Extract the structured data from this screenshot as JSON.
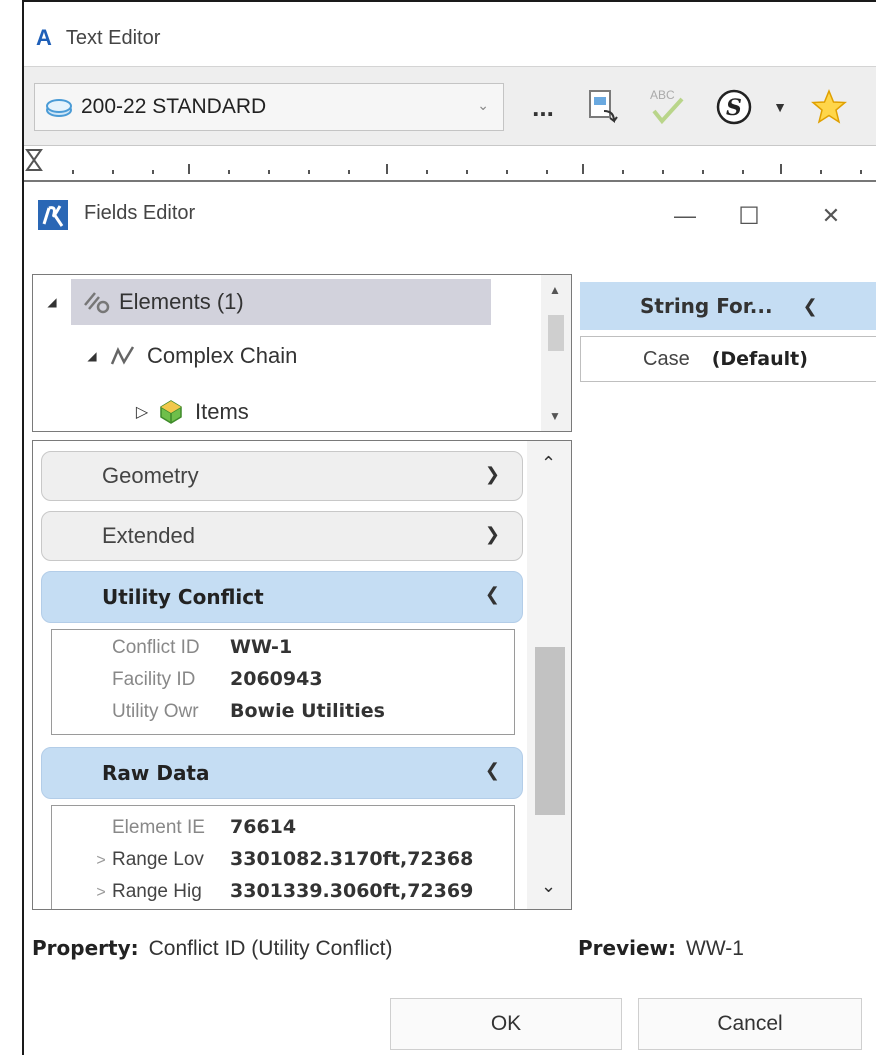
{
  "text_editor": {
    "title": "Text Editor",
    "glyph": "A"
  },
  "toolbar": {
    "text_style": "200-22 STANDARD",
    "more_label": "...",
    "spell_label": "ABC",
    "symbol_label": "S"
  },
  "fields_editor": {
    "title": "Fields Editor",
    "minimize": "—",
    "maximize": "☐",
    "close": "✕"
  },
  "tree": {
    "items": [
      {
        "label": "Elements (1)",
        "expander": "◢"
      },
      {
        "label": "Complex Chain",
        "expander": "◢"
      },
      {
        "label": "Items",
        "expander": "▷"
      }
    ]
  },
  "groups": {
    "geometry": "Geometry",
    "extended": "Extended",
    "utility_conflict": {
      "label": "Utility Conflict",
      "rows": [
        {
          "key": "Conflict ID",
          "value": "WW-1"
        },
        {
          "key": "Facility ID",
          "value": "2060943"
        },
        {
          "key": "Utility Owr",
          "value": "Bowie Utilities"
        }
      ]
    },
    "raw_data": {
      "label": "Raw Data",
      "rows": [
        {
          "key": "Element IE",
          "value": "76614",
          "expander": ""
        },
        {
          "key": "Range Lov",
          "value": "3301082.3170ft,72368",
          "expander": ">"
        },
        {
          "key": "Range Hig",
          "value": "3301339.3060ft,72369",
          "expander": ">"
        }
      ]
    }
  },
  "string_format": {
    "header": "String For...",
    "case_label": "Case",
    "case_value": "(Default)"
  },
  "footer": {
    "property_label": "Property:",
    "property_value": "Conflict ID (Utility Conflict)",
    "preview_label": "Preview:",
    "preview_value": "WW-1",
    "ok": "OK",
    "cancel": "Cancel"
  }
}
